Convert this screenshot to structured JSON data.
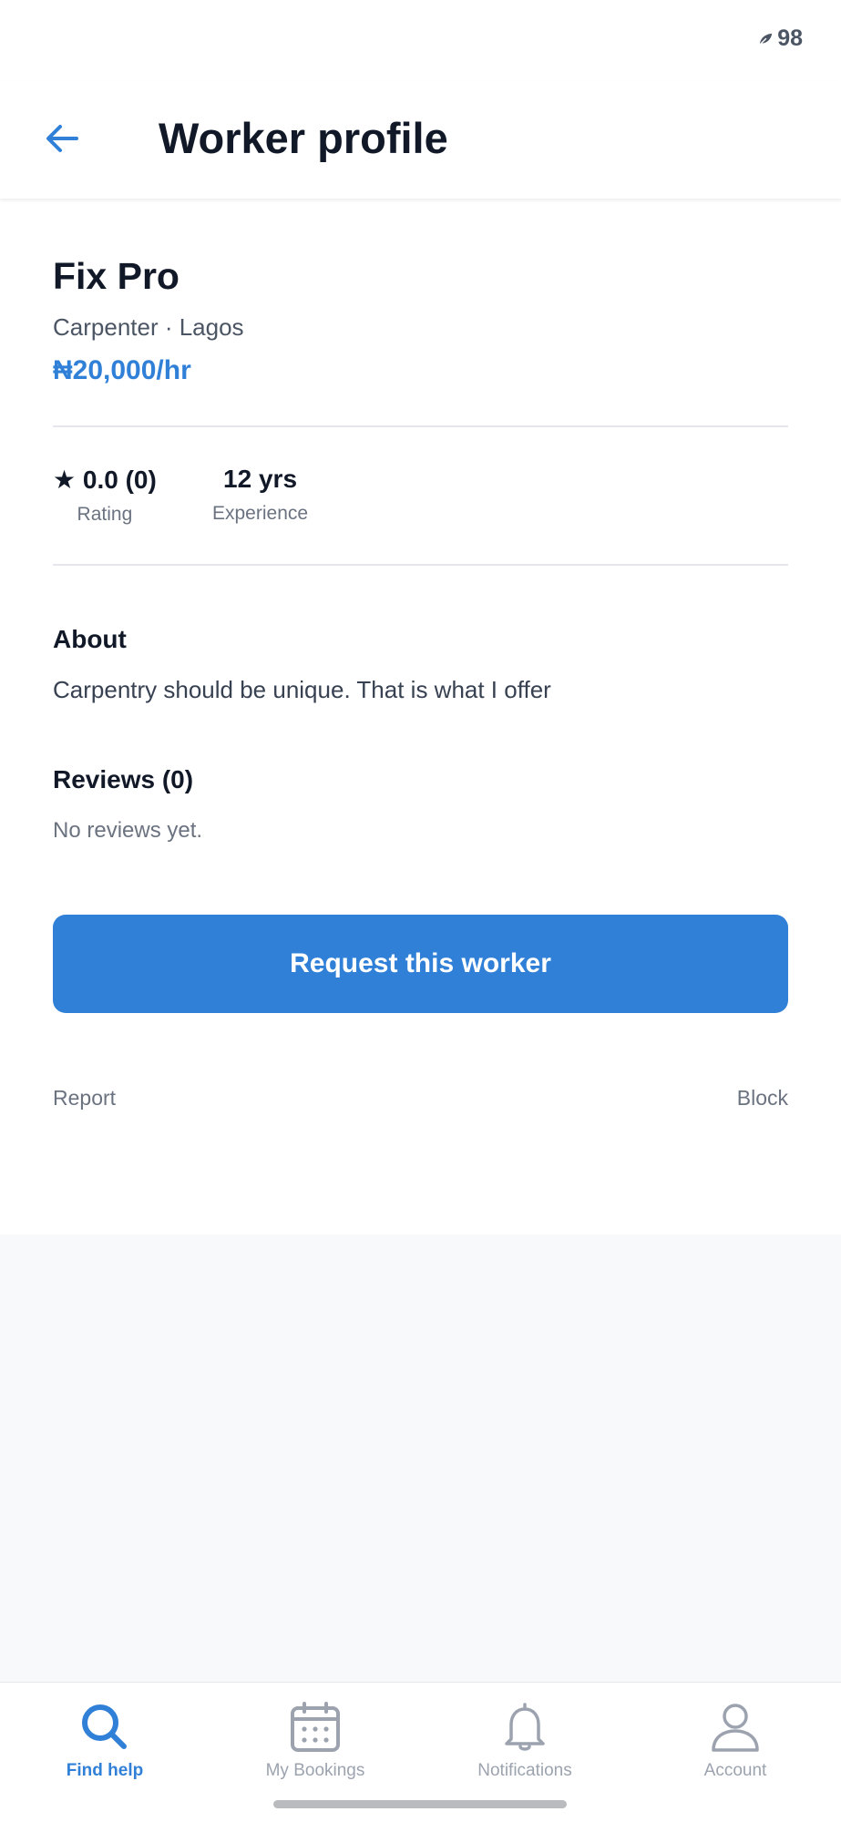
{
  "status_bar": {
    "battery": "98",
    "battery_icon": "leaf-battery-icon"
  },
  "header": {
    "title": "Worker profile",
    "back_icon": "arrow-left-icon"
  },
  "worker": {
    "name": "Fix Pro",
    "meta": "Carpenter · Lagos",
    "rate": "₦20,000/hr"
  },
  "stats": {
    "rating_value": "★ 0.0 (0)",
    "rating_label": "Rating",
    "experience_value": "12 yrs",
    "experience_label": "Experience"
  },
  "about": {
    "heading": "About",
    "text": "Carpentry should be unique. That is what I offer"
  },
  "reviews": {
    "heading": "Reviews (0)",
    "empty_text": "No reviews yet."
  },
  "actions": {
    "request_label": "Request this worker",
    "report_label": "Report",
    "block_label": "Block"
  },
  "bottom_nav": {
    "items": [
      {
        "label": "Find help",
        "icon": "search-icon",
        "active": true
      },
      {
        "label": "My Bookings",
        "icon": "calendar-icon",
        "active": false
      },
      {
        "label": "Notifications",
        "icon": "bell-icon",
        "active": false
      },
      {
        "label": "Account",
        "icon": "person-icon",
        "active": false
      }
    ]
  },
  "colors": {
    "accent": "#3180d8",
    "text_primary": "#111827",
    "text_secondary": "#6b7280",
    "background": "#f8f9fb"
  }
}
